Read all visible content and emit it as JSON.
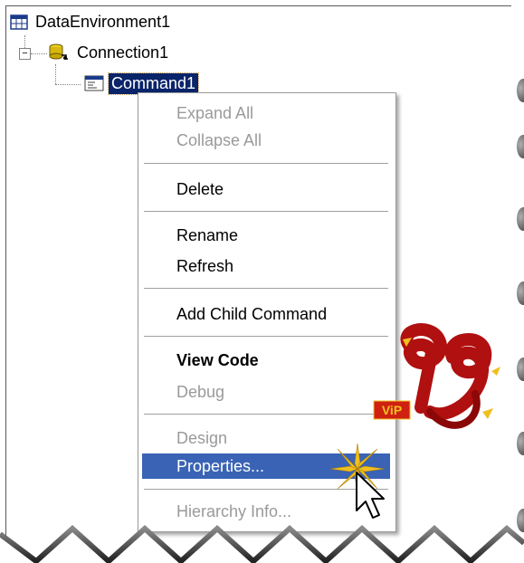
{
  "tree": {
    "root_label": "DataEnvironment1",
    "connection_label": "Connection1",
    "command_label": "Command1"
  },
  "context_menu": {
    "items": [
      {
        "label": "Expand All",
        "state": "disabled"
      },
      {
        "label": "Collapse All",
        "state": "disabled"
      },
      {
        "label": "Delete",
        "state": "enabled"
      },
      {
        "label": "Rename",
        "state": "enabled"
      },
      {
        "label": "Refresh",
        "state": "enabled"
      },
      {
        "label": "Add Child Command",
        "state": "enabled"
      },
      {
        "label": "View Code",
        "state": "bold"
      },
      {
        "label": "Debug",
        "state": "disabled"
      },
      {
        "label": "Design",
        "state": "disabled"
      },
      {
        "label": "Properties...",
        "state": "highlighted"
      },
      {
        "label": "Hierarchy Info...",
        "state": "disabled"
      }
    ]
  },
  "watermark": {
    "badge_text": "ViP",
    "logo_text": "192"
  },
  "colors": {
    "selection": "#0a246a",
    "menu_highlight": "#3a63b5",
    "disabled_text": "#9a9a9a",
    "logo_red": "#b01010",
    "sparkle": "#f0c020"
  }
}
